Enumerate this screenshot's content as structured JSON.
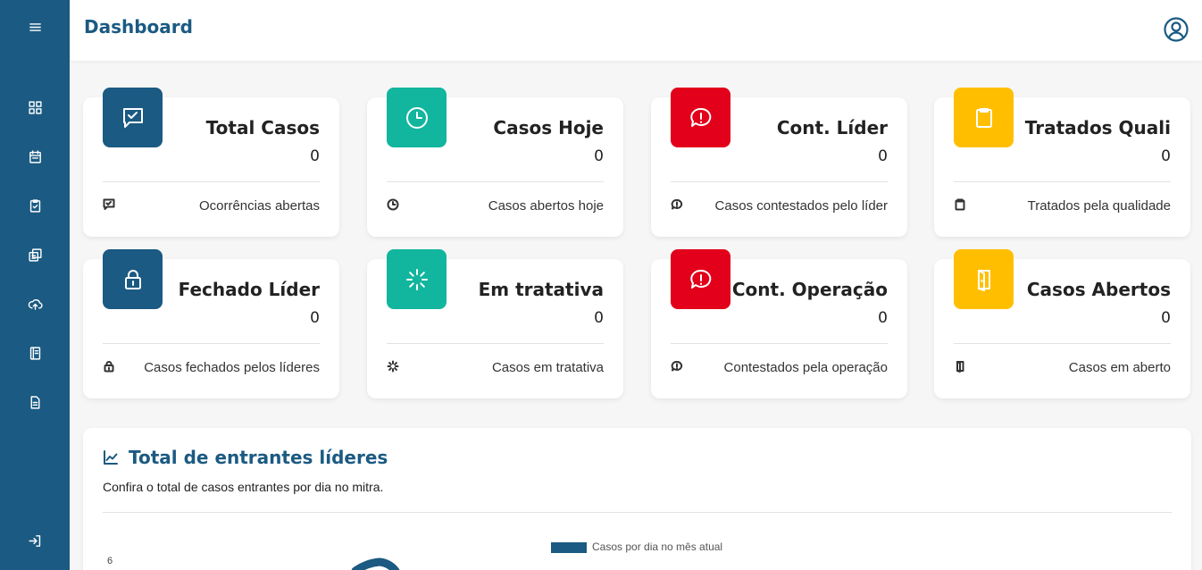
{
  "header": {
    "title": "Dashboard",
    "menu_icon": "hamburger-icon",
    "user_icon": "user-circle-icon"
  },
  "sidebar": {
    "items": [
      {
        "name": "dashboard",
        "icon": "grid-icon"
      },
      {
        "name": "calendar",
        "icon": "calendar-icon"
      },
      {
        "name": "checklist",
        "icon": "clipboard-check-icon"
      },
      {
        "name": "copy",
        "icon": "copy-icon"
      },
      {
        "name": "upload",
        "icon": "cloud-upload-icon"
      },
      {
        "name": "book",
        "icon": "book-icon"
      },
      {
        "name": "document",
        "icon": "document-icon"
      }
    ],
    "logout_icon": "logout-icon"
  },
  "colors": {
    "primary": "#1b5a82",
    "teal": "#12b59e",
    "red": "#e2001a",
    "yellow": "#ffbf00"
  },
  "cards": [
    {
      "title": "Total Casos",
      "value": "0",
      "footer": "Ocorrências abertas",
      "icon": "chat-check-icon",
      "color": "#1b5a82"
    },
    {
      "title": "Casos Hoje",
      "value": "0",
      "footer": "Casos abertos hoje",
      "icon": "clock-icon",
      "color": "#12b59e"
    },
    {
      "title": "Cont. Líder",
      "value": "0",
      "footer": "Casos contestados pelo líder",
      "icon": "alert-bubble-icon",
      "color": "#e2001a"
    },
    {
      "title": "Tratados Quali",
      "value": "0",
      "footer": "Tratados pela qualidade",
      "icon": "clipboard-icon",
      "color": "#ffbf00"
    },
    {
      "title": "Fechado Líder",
      "value": "0",
      "footer": "Casos fechados pelos líderes",
      "icon": "lock-icon",
      "color": "#1b5a82"
    },
    {
      "title": "Em tratativa",
      "value": "0",
      "footer": "Casos em tratativa",
      "icon": "loader-icon",
      "color": "#12b59e"
    },
    {
      "title": "Cont. Operação",
      "value": "0",
      "footer": "Contestados pela operação",
      "icon": "alert-bubble-icon",
      "color": "#e2001a"
    },
    {
      "title": "Casos Abertos",
      "value": "0",
      "footer": "Casos em aberto",
      "icon": "door-open-icon",
      "color": "#ffbf00"
    }
  ],
  "chart_panel": {
    "title": "Total de entrantes líderes",
    "subtitle": "Confira o total de casos entrantes por dia no mitra.",
    "icon": "line-chart-icon"
  },
  "chart_data": {
    "type": "line",
    "series": [
      {
        "name": "Casos por dia no mês atual",
        "color": "#1b5a82"
      }
    ],
    "y_ticks": [
      "6"
    ]
  }
}
